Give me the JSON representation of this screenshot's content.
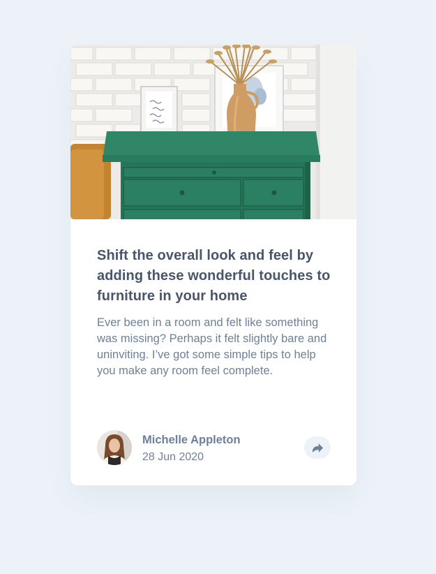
{
  "article": {
    "title": "Shift the overall look and feel by adding these wonderful touches to furniture in your home",
    "excerpt": "Ever been in a room and felt like something was missing? Perhaps it felt slightly bare and uninviting. I’ve got some simple tips to help you make any room feel complete.",
    "image_icon": "drawers-photo"
  },
  "author": {
    "name": "Michelle Appleton",
    "date": "28 Jun 2020",
    "avatar_icon": "avatar-photo"
  },
  "share": {
    "icon": "share-arrow-icon"
  },
  "colors": {
    "background": "#ECF2F8",
    "card": "#FFFFFF",
    "heading": "#48556A",
    "body_text": "#6E8098",
    "share_bg": "#ECF2F8"
  }
}
